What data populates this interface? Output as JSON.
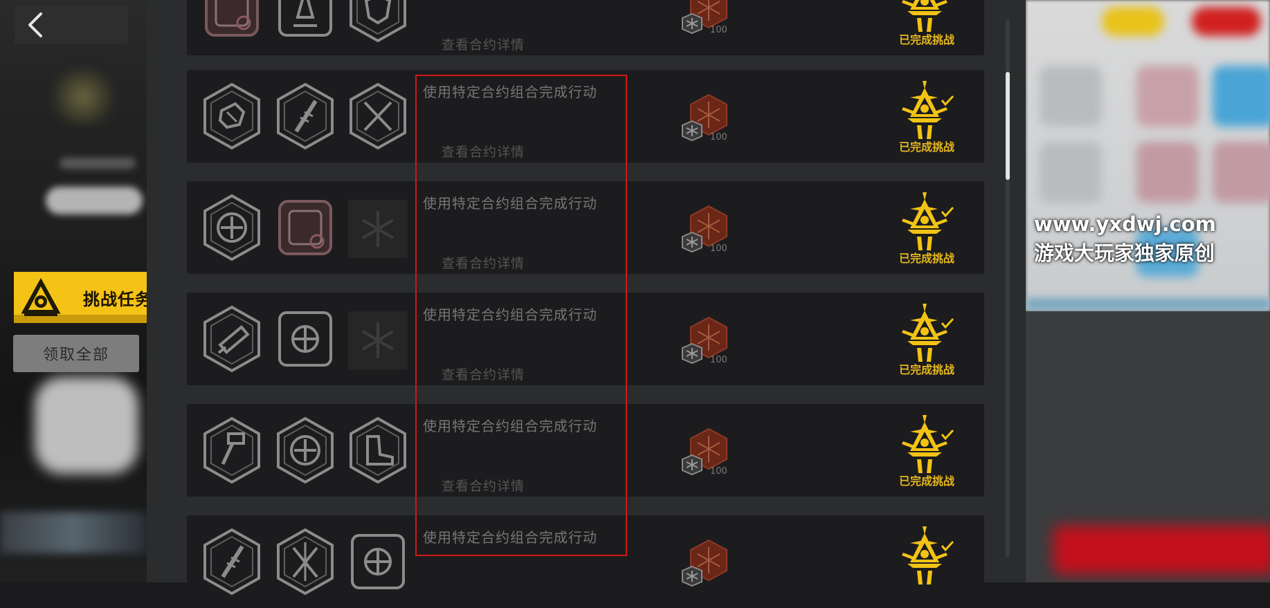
{
  "nav": {
    "back_icon": "chevron-left-icon"
  },
  "sidebar": {
    "challenge_tab_label": "挑战任务",
    "challenge_tab_color": "#f5c216",
    "claim_all_label": "领取全部"
  },
  "tasks": [
    {
      "title": "",
      "detail": "查看合约详情",
      "reward_count": "100",
      "status": "已完成挑战",
      "contract_icons": [
        "contract-conflict-icon",
        "flame-tower-icon",
        "shield-badge-icon"
      ]
    },
    {
      "title": "使用特定合约组合完成行动",
      "detail": "查看合约详情",
      "reward_count": "100",
      "status": "已完成挑战",
      "contract_icons": [
        "armored-fist-icon",
        "spine-blade-icon",
        "crossed-swords-icon"
      ]
    },
    {
      "title": "使用特定合约组合完成行动",
      "detail": "查看合约详情",
      "reward_count": "100",
      "status": "已完成挑战",
      "contract_icons": [
        "crosshair-target-icon",
        "contract-conflict-icon",
        "snowflake-icon"
      ]
    },
    {
      "title": "使用特定合约组合完成行动",
      "detail": "查看合约详情",
      "reward_count": "100",
      "status": "已完成挑战",
      "contract_icons": [
        "rocket-launcher-icon",
        "targeting-grid-icon",
        "snowflake-icon"
      ]
    },
    {
      "title": "使用特定合约组合完成行动",
      "detail": "查看合约详情",
      "reward_count": "100",
      "status": "已完成挑战",
      "contract_icons": [
        "broken-hammer-icon",
        "crosshair-target-icon",
        "armored-boot-icon"
      ]
    },
    {
      "title": "使用特定合约组合完成行动",
      "detail": "",
      "reward_count": "",
      "status": "",
      "contract_icons": [
        "spine-blade-icon",
        "crossed-blades-icon",
        "targeting-grid-icon"
      ]
    }
  ],
  "watermark": {
    "url": "www.yxdwj.com",
    "tagline": "游戏大玩家独家原创"
  },
  "colors": {
    "gold": "#e8b81c",
    "highlight_box": "#d01818",
    "reward_red": "#8a2a1a"
  }
}
